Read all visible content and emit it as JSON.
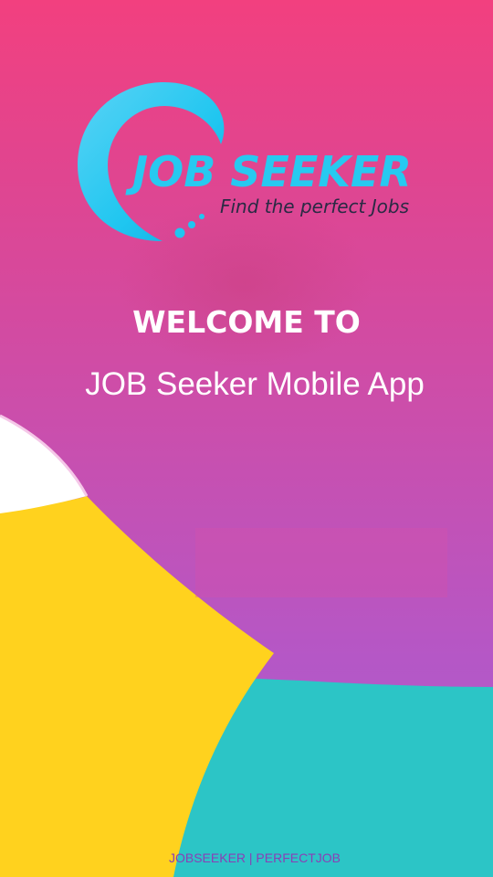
{
  "splash": {
    "logo": {
      "title": "JOB SEEKER",
      "tagline": "Find the perfect Jobs"
    },
    "welcome_heading": "WELCOME TO",
    "app_subtitle": "JOB Seeker Mobile App",
    "footer_text": "JOBSEEKER | PERFECTJOB"
  },
  "colors": {
    "gradient_top": "#f2407f",
    "gradient_bottom": "#a95dd0",
    "teal": "#2cc5c6",
    "yellow": "#ffd21e",
    "logo_blue": "#27c9f0"
  },
  "icons": [
    "logo-swoosh-icon"
  ]
}
